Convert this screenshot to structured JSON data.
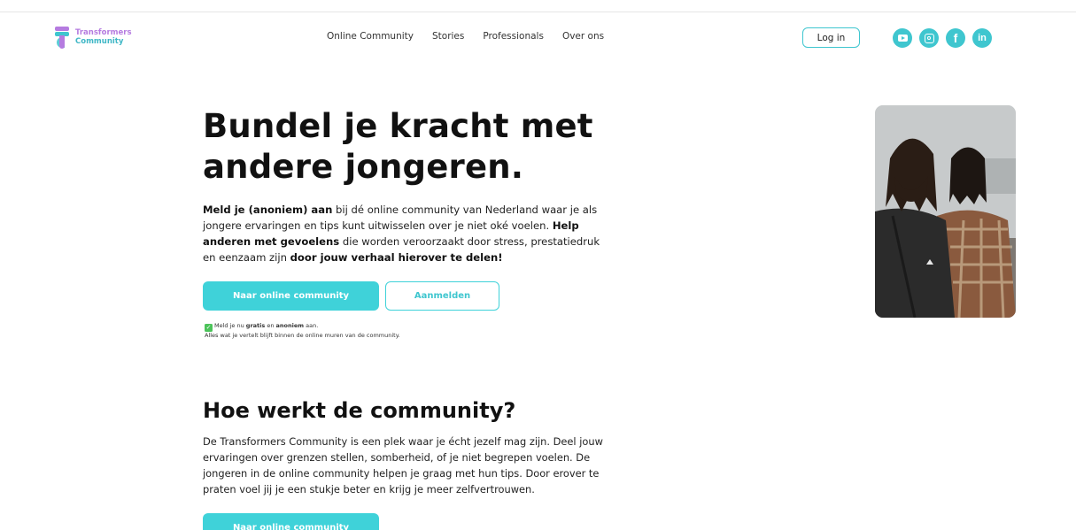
{
  "brand": {
    "line1": "Transformers",
    "line2": "Community"
  },
  "nav": [
    "Online Community",
    "Stories",
    "Professionals",
    "Over ons"
  ],
  "header": {
    "login_label": "Log in"
  },
  "socials": [
    "youtube-icon",
    "instagram-icon",
    "facebook-icon",
    "linkedin-icon"
  ],
  "hero": {
    "title_line1": "Bundel je kracht met",
    "title_line2": "andere jongeren.",
    "intro_bold1": "Meld je (anoniem) aan",
    "intro_text1": " bij dé online community van Nederland waar je als jongere ervaringen en tips kunt uitwisselen over je niet oké voelen. ",
    "intro_bold2": "Help anderen met gevoelens",
    "intro_text2": " die worden veroorzaakt door stress, prestatiedruk en eenzaam zijn ",
    "intro_bold3": "door jouw verhaal hierover te delen!",
    "primary_button": "Naar online community",
    "secondary_button": "Aanmelden",
    "note_prefix": "Meld je nu ",
    "note_bold1": "gratis",
    "note_mid": " en ",
    "note_bold2": "anoniem",
    "note_suffix": " aan.",
    "note_line2": "Alles wat je vertelt blijft binnen de online muren van de community."
  },
  "how": {
    "title": "Hoe werkt de community?",
    "text": "De Transformers Community is een plek waar je écht jezelf mag zijn. Deel jouw ervaringen over grenzen stellen, somberheid, of je niet begrepen voelen. De jongeren in de online community helpen je graag met hun tips. Door erover te praten voel jij je een stukje beter en krijg je meer zelfvertrouwen.",
    "button": "Naar online community"
  },
  "colors": {
    "accent": "#3fd2d9",
    "brand_purple": "#b57be0",
    "check_green": "#4cc35a"
  }
}
